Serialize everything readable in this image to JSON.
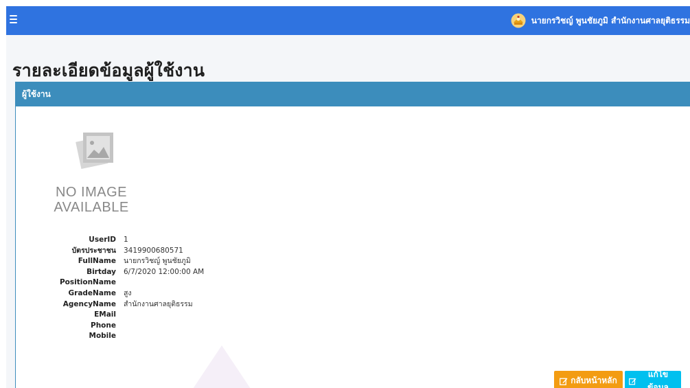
{
  "header": {
    "menu_icon": "hamburger-icon",
    "user_icon": "court-emblem-icon",
    "user_text": "นายกรวิชญ์ พูนชัยภูมิ สำนักงานศาลยุติธรรม"
  },
  "page": {
    "title": "รายละเอียดข้อมูลผู้ใช้งาน"
  },
  "panel": {
    "title": "ผู้ใช้งาน",
    "photo_icon": "no-image-placeholder-icon",
    "photo_text_line1": "NO IMAGE",
    "photo_text_line2": "AVAILABLE"
  },
  "fields": [
    {
      "label": "UserID",
      "value": "1"
    },
    {
      "label": "บัตรประชาชน",
      "value": "3419900680571"
    },
    {
      "label": "FullName",
      "value": "นายกรวิชญ์ พูนชัยภูมิ"
    },
    {
      "label": "Birtday",
      "value": "6/7/2020 12:00:00 AM"
    },
    {
      "label": "PositionName",
      "value": ""
    },
    {
      "label": "GradeName",
      "value": "สูง"
    },
    {
      "label": "AgencyName",
      "value": "สำนักงานศาลยุติธรรม"
    },
    {
      "label": "EMail",
      "value": ""
    },
    {
      "label": "Phone",
      "value": ""
    },
    {
      "label": "Mobile",
      "value": ""
    }
  ],
  "buttons": {
    "home_label": "กลับหน้าหลัก",
    "edit_label": "แก้ไขข้อมูล",
    "icon": "edit-icon"
  },
  "colors": {
    "topbar": "#2f73e0",
    "panel_header": "#3c8dbc",
    "home_button": "#f39c12",
    "edit_button": "#00c0ef"
  }
}
